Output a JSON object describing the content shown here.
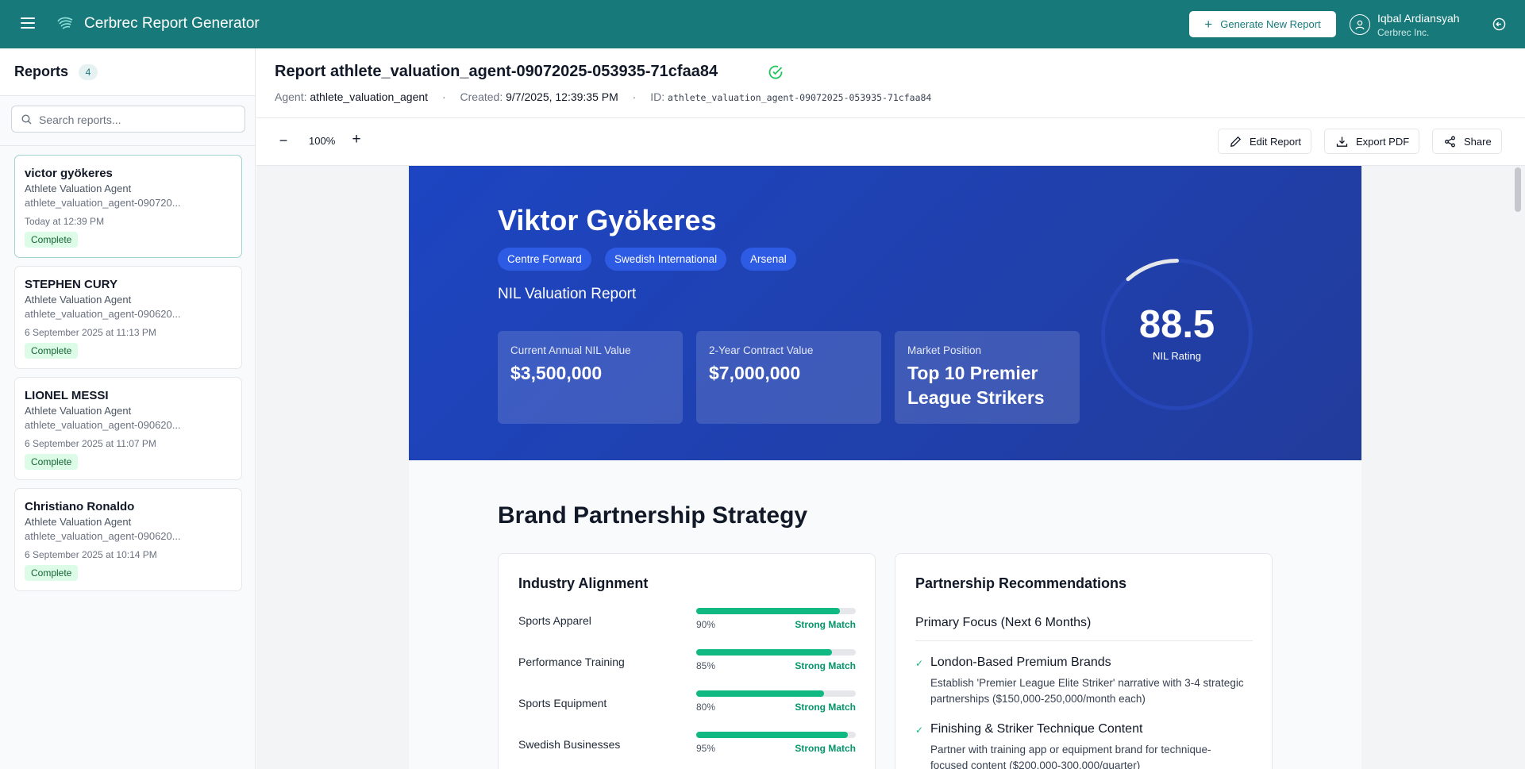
{
  "app": {
    "title": "Cerbrec Report Generator",
    "generate_label": "Generate New Report",
    "user_name": "Iqbal Ardiansyah",
    "user_org": "Cerbrec Inc."
  },
  "sidebar": {
    "title": "Reports",
    "count": "4",
    "search_placeholder": "Search reports...",
    "reports": [
      {
        "name": "victor gyökeres",
        "agent": "Athlete Valuation Agent",
        "id": "athlete_valuation_agent-090720...",
        "time": "Today at 12:39 PM",
        "status": "Complete"
      },
      {
        "name": "STEPHEN CURY",
        "agent": "Athlete Valuation Agent",
        "id": "athlete_valuation_agent-090620...",
        "time": "6 September 2025 at 11:13 PM",
        "status": "Complete"
      },
      {
        "name": "LIONEL MESSI",
        "agent": "Athlete Valuation Agent",
        "id": "athlete_valuation_agent-090620...",
        "time": "6 September 2025 at 11:07 PM",
        "status": "Complete"
      },
      {
        "name": "Christiano Ronaldo",
        "agent": "Athlete Valuation Agent",
        "id": "athlete_valuation_agent-090620...",
        "time": "6 September 2025 at 10:14 PM",
        "status": "Complete"
      }
    ]
  },
  "report": {
    "title": "Report athlete_valuation_agent-09072025-053935-71cfaa84",
    "agent_label": "Agent:",
    "agent": "athlete_valuation_agent",
    "created_label": "Created:",
    "created": "9/7/2025, 12:39:35 PM",
    "id_label": "ID:",
    "id": "athlete_valuation_agent-09072025-053935-71cfaa84",
    "separator": "·"
  },
  "toolbar": {
    "zoom_minus": "−",
    "zoom": "100%",
    "zoom_plus": "+",
    "edit_label": "Edit Report",
    "export_label": "Export PDF",
    "share_label": "Share"
  },
  "doc": {
    "athlete_name": "Viktor Gyökeres",
    "tags": [
      "Centre Forward",
      "Swedish International",
      "Arsenal"
    ],
    "subtitle": "NIL Valuation Report",
    "stats": [
      {
        "label": "Current Annual NIL Value",
        "value": "$3,500,000"
      },
      {
        "label": "2-Year Contract Value",
        "value": "$7,000,000"
      },
      {
        "label": "Market Position",
        "value": "Top 10 Premier League Strikers"
      }
    ],
    "rating_value": "88.5",
    "rating_label": "NIL Rating",
    "rating_max": 100,
    "section_title": "Brand Partnership Strategy",
    "industry": {
      "title": "Industry Alignment",
      "rows": [
        {
          "name": "Sports Apparel",
          "pct_label": "90%",
          "pct": 90,
          "match": "Strong Match"
        },
        {
          "name": "Performance Training",
          "pct_label": "85%",
          "pct": 85,
          "match": "Strong Match"
        },
        {
          "name": "Sports Equipment",
          "pct_label": "80%",
          "pct": 80,
          "match": "Strong Match"
        },
        {
          "name": "Swedish Businesses",
          "pct_label": "95%",
          "pct": 95,
          "match": "Strong Match"
        }
      ]
    },
    "partnerships": {
      "title": "Partnership Recommendations",
      "subtitle": "Primary Focus (Next 6 Months)",
      "items": [
        {
          "head": "London-Based Premium Brands",
          "desc": "Establish 'Premier League Elite Striker' narrative with 3-4 strategic partnerships ($150,000-250,000/month each)"
        },
        {
          "head": "Finishing & Striker Technique Content",
          "desc": "Partner with training app or equipment brand for technique-focused content ($200,000-300,000/quarter)"
        }
      ]
    }
  },
  "colors": {
    "topbar": "#17797a",
    "hero": "#1d45c2",
    "accent_green": "#10b981"
  }
}
